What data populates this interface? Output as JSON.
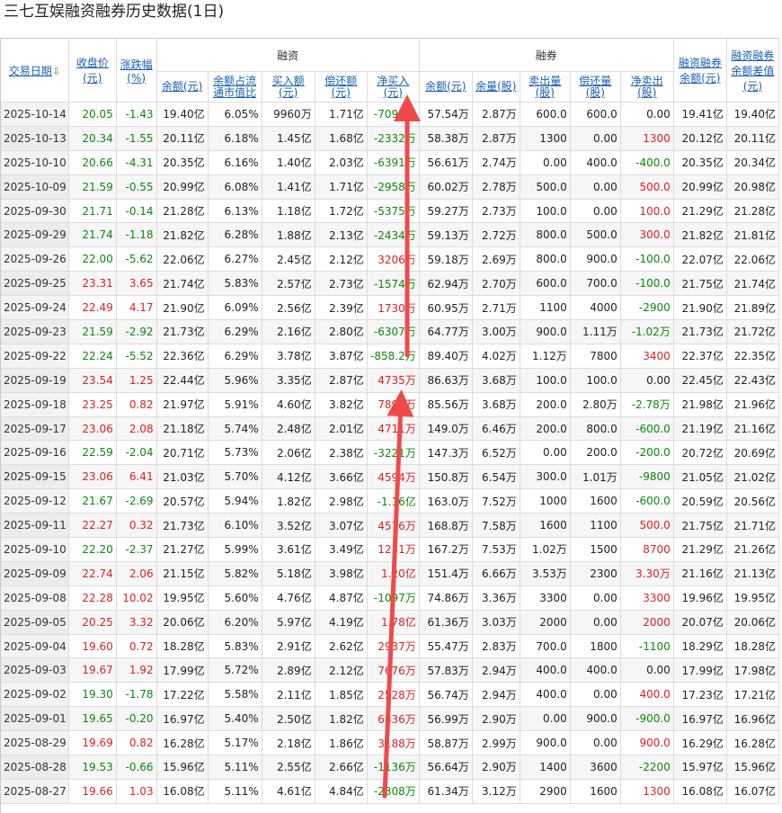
{
  "title": "三七互娱融资融券历史数据(1日)",
  "headers": {
    "date": "交易日期",
    "close": "收盘价\n(元)",
    "chg": "涨跌幅\n(%)",
    "rz_group": "融资",
    "rq_group": "融券",
    "rz_bal": "余额(元)",
    "rz_ratio": "余额占流\n通市值比",
    "rz_buy": "买入额\n(元)",
    "rz_repay": "偿还额\n(元)",
    "rz_net": "净买入\n(元)",
    "rq_bal": "余额(元)",
    "rq_vol": "余量(股)",
    "rq_sell": "卖出量\n(股)",
    "rq_repay": "偿还量\n(股)",
    "rq_net": "净卖出\n(股)",
    "total": "融资融券\n余额(元)",
    "diff": "融资融券\n余额差值\n(元)"
  },
  "colors": {
    "up": "#e02020",
    "down": "#0a8a0a",
    "arrow": "#ef4a4a",
    "link": "#1a5fb4"
  },
  "rows": [
    [
      "2025-10-14",
      "20.05",
      "-1.43",
      "19.40亿",
      "6.05%",
      "9960万",
      "1.71亿",
      "-7093万",
      "57.54万",
      "2.87万",
      "600.0",
      "600.0",
      "0.00",
      "19.41亿",
      "19.40亿"
    ],
    [
      "2025-10-13",
      "20.34",
      "-1.55",
      "20.11亿",
      "6.18%",
      "1.45亿",
      "1.68亿",
      "-2332万",
      "58.38万",
      "2.87万",
      "1300",
      "0.00",
      "1300",
      "20.12亿",
      "20.11亿"
    ],
    [
      "2025-10-10",
      "20.66",
      "-4.31",
      "20.35亿",
      "6.16%",
      "1.40亿",
      "2.03亿",
      "-6391万",
      "56.61万",
      "2.74万",
      "0.00",
      "400.0",
      "-400.0",
      "20.35亿",
      "20.34亿"
    ],
    [
      "2025-10-09",
      "21.59",
      "-0.55",
      "20.99亿",
      "6.08%",
      "1.41亿",
      "1.71亿",
      "-2958万",
      "60.02万",
      "2.78万",
      "500.0",
      "0.00",
      "500.0",
      "20.99亿",
      "20.98亿"
    ],
    [
      "2025-09-30",
      "21.71",
      "-0.14",
      "21.28亿",
      "6.13%",
      "1.18亿",
      "1.72亿",
      "-5375万",
      "59.27万",
      "2.73万",
      "100.0",
      "0.00",
      "100.0",
      "21.29亿",
      "21.28亿"
    ],
    [
      "2025-09-29",
      "21.74",
      "-1.18",
      "21.82亿",
      "6.28%",
      "1.88亿",
      "2.13亿",
      "-2434万",
      "59.13万",
      "2.72万",
      "800.0",
      "500.0",
      "300.0",
      "21.82亿",
      "21.81亿"
    ],
    [
      "2025-09-26",
      "22.00",
      "-5.62",
      "22.06亿",
      "6.27%",
      "2.45亿",
      "2.12亿",
      "3206万",
      "59.18万",
      "2.69万",
      "800.0",
      "900.0",
      "-100.0",
      "22.07亿",
      "22.06亿"
    ],
    [
      "2025-09-25",
      "23.31",
      "3.65",
      "21.74亿",
      "5.83%",
      "2.57亿",
      "2.73亿",
      "-1574万",
      "62.94万",
      "2.70万",
      "600.0",
      "700.0",
      "-100.0",
      "21.75亿",
      "21.74亿"
    ],
    [
      "2025-09-24",
      "22.49",
      "4.17",
      "21.90亿",
      "6.09%",
      "2.56亿",
      "2.39亿",
      "1730万",
      "60.95万",
      "2.71万",
      "1100",
      "4000",
      "-2900",
      "21.90亿",
      "21.89亿"
    ],
    [
      "2025-09-23",
      "21.59",
      "-2.92",
      "21.73亿",
      "6.29%",
      "2.16亿",
      "2.80亿",
      "-6307万",
      "64.77万",
      "3.00万",
      "900.0",
      "1.11万",
      "-1.02万",
      "21.73亿",
      "21.72亿"
    ],
    [
      "2025-09-22",
      "22.24",
      "-5.52",
      "22.36亿",
      "6.29%",
      "3.78亿",
      "3.87亿",
      "-858.2万",
      "89.40万",
      "4.02万",
      "1.12万",
      "7800",
      "3400",
      "22.37亿",
      "22.35亿"
    ],
    [
      "2025-09-19",
      "23.54",
      "1.25",
      "22.44亿",
      "5.96%",
      "3.35亿",
      "2.87亿",
      "4735万",
      "86.63万",
      "3.68万",
      "100.0",
      "100.0",
      "0.00",
      "22.45亿",
      "22.43亿"
    ],
    [
      "2025-09-18",
      "23.25",
      "0.82",
      "21.97亿",
      "5.91%",
      "4.60亿",
      "3.82亿",
      "7892万",
      "85.56万",
      "3.68万",
      "200.0",
      "2.80万",
      "-2.78万",
      "21.98亿",
      "21.96亿"
    ],
    [
      "2025-09-17",
      "23.06",
      "2.08",
      "21.18亿",
      "5.74%",
      "2.48亿",
      "2.01亿",
      "4711万",
      "149.0万",
      "6.46万",
      "200.0",
      "800.0",
      "-600.0",
      "21.19亿",
      "21.16亿"
    ],
    [
      "2025-09-16",
      "22.59",
      "-2.04",
      "20.71亿",
      "5.73%",
      "2.06亿",
      "2.38亿",
      "-3221万",
      "147.3万",
      "6.52万",
      "0.00",
      "200.0",
      "-200.0",
      "20.72亿",
      "20.69亿"
    ],
    [
      "2025-09-15",
      "23.06",
      "6.41",
      "21.03亿",
      "5.70%",
      "4.12亿",
      "3.66亿",
      "4594万",
      "150.8万",
      "6.54万",
      "300.0",
      "1.01万",
      "-9800",
      "21.05亿",
      "21.02亿"
    ],
    [
      "2025-09-12",
      "21.67",
      "-2.69",
      "20.57亿",
      "5.94%",
      "1.82亿",
      "2.98亿",
      "-1.16亿",
      "163.0万",
      "7.52万",
      "1000",
      "1600",
      "-600.0",
      "20.59亿",
      "20.56亿"
    ],
    [
      "2025-09-11",
      "22.27",
      "0.32",
      "21.73亿",
      "6.10%",
      "3.52亿",
      "3.07亿",
      "4576万",
      "168.8万",
      "7.58万",
      "1600",
      "1100",
      "500.0",
      "21.75亿",
      "21.71亿"
    ],
    [
      "2025-09-10",
      "22.20",
      "-2.37",
      "21.27亿",
      "5.99%",
      "3.61亿",
      "3.49亿",
      "1231万",
      "167.2万",
      "7.53万",
      "1.02万",
      "1500",
      "8700",
      "21.29亿",
      "21.26亿"
    ],
    [
      "2025-09-09",
      "22.74",
      "2.06",
      "21.15亿",
      "5.82%",
      "5.18亿",
      "3.98亿",
      "1.20亿",
      "151.4万",
      "6.66万",
      "3.53万",
      "2300",
      "3.30万",
      "21.16亿",
      "21.13亿"
    ],
    [
      "2025-09-08",
      "22.28",
      "10.02",
      "19.95亿",
      "5.60%",
      "4.76亿",
      "4.87亿",
      "-1097万",
      "74.86万",
      "3.36万",
      "3300",
      "0.00",
      "3300",
      "19.96亿",
      "19.95亿"
    ],
    [
      "2025-09-05",
      "20.25",
      "3.32",
      "20.06亿",
      "6.20%",
      "5.97亿",
      "4.19亿",
      "1.78亿",
      "61.36万",
      "3.03万",
      "2000",
      "0.00",
      "2000",
      "20.07亿",
      "20.06亿"
    ],
    [
      "2025-09-04",
      "19.60",
      "0.72",
      "18.28亿",
      "5.83%",
      "2.91亿",
      "2.62亿",
      "2937万",
      "55.47万",
      "2.83万",
      "700.0",
      "1800",
      "-1100",
      "18.29亿",
      "18.28亿"
    ],
    [
      "2025-09-03",
      "19.67",
      "1.92",
      "17.99亿",
      "5.72%",
      "2.89亿",
      "2.12亿",
      "7676万",
      "57.83万",
      "2.94万",
      "400.0",
      "400.0",
      "0.00",
      "17.99亿",
      "17.98亿"
    ],
    [
      "2025-09-02",
      "19.30",
      "-1.78",
      "17.22亿",
      "5.58%",
      "2.11亿",
      "1.85亿",
      "2528万",
      "56.74万",
      "2.94万",
      "400.0",
      "0.00",
      "400.0",
      "17.23亿",
      "17.21亿"
    ],
    [
      "2025-09-01",
      "19.65",
      "-0.20",
      "16.97亿",
      "5.40%",
      "2.50亿",
      "1.82亿",
      "6836万",
      "56.99万",
      "2.90万",
      "0.00",
      "900.0",
      "-900.0",
      "16.97亿",
      "16.96亿"
    ],
    [
      "2025-08-29",
      "19.69",
      "0.82",
      "16.28亿",
      "5.17%",
      "2.18亿",
      "1.86亿",
      "3188万",
      "58.87万",
      "2.99万",
      "900.0",
      "0.00",
      "900.0",
      "16.29亿",
      "16.28亿"
    ],
    [
      "2025-08-28",
      "19.53",
      "-0.66",
      "15.96亿",
      "5.11%",
      "2.55亿",
      "2.66亿",
      "-1136万",
      "56.64万",
      "2.90万",
      "1400",
      "3600",
      "-2200",
      "15.97亿",
      "15.96亿"
    ],
    [
      "2025-08-27",
      "19.66",
      "1.03",
      "16.08亿",
      "5.11%",
      "4.61亿",
      "4.84亿",
      "-2308万",
      "61.34万",
      "3.12万",
      "2900",
      "1600",
      "1300",
      "16.08亿",
      "16.07亿"
    ]
  ]
}
